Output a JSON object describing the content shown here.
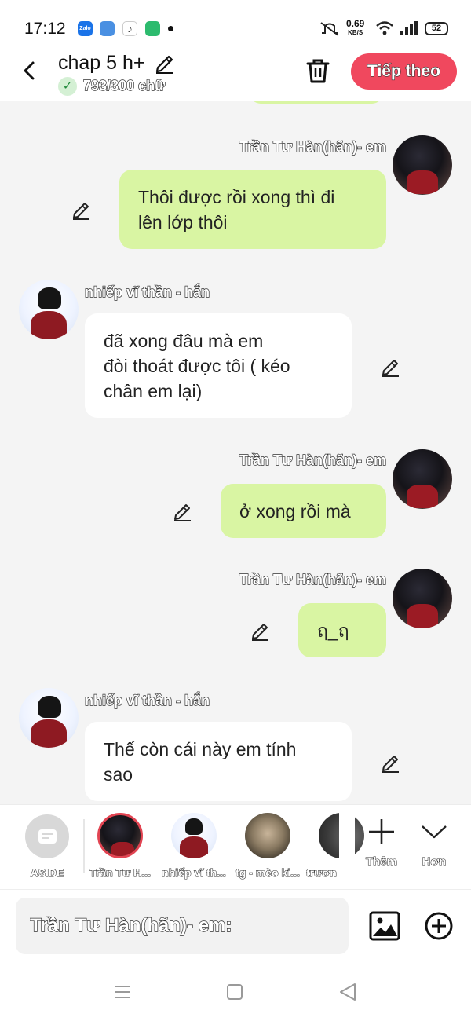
{
  "status_bar": {
    "time": "17:12",
    "apps": [
      "zalo-icon",
      "app-icon",
      "tiktok-icon",
      "battery-saver-icon"
    ],
    "net_speed": "0.69",
    "net_unit": "KB/S",
    "battery": "52",
    "icons": [
      "mute-icon",
      "wifi-icon",
      "signal-icon",
      "battery-icon"
    ]
  },
  "header": {
    "title": "chap 5 h+",
    "word_count": "793/300 chữ",
    "next_label": "Tiếp theo",
    "icons": [
      "back-icon",
      "edit-title-icon",
      "trash-icon"
    ]
  },
  "messages": [
    {
      "side": "right",
      "sender": "Trần Tư Hàn(hãn)- em",
      "avatar": "tran-avatar",
      "text_lines": [
        "Thôi được rồi xong thì đi",
        "lên lớp thôi"
      ]
    },
    {
      "side": "left",
      "sender": "nhiếp vĩ thần - hắn",
      "avatar": "nhiep-avatar",
      "text_lines": [
        "đã xong đâu mà em",
        "đòi thoát được tôi ( kéo",
        "chân em lại)"
      ]
    },
    {
      "side": "right",
      "sender": "Trần Tư Hàn(hãn)- em",
      "avatar": "tran-avatar",
      "text_lines": [
        "ở xong rồi mà"
      ]
    },
    {
      "side": "right",
      "sender": "Trần Tư Hàn(hãn)- em",
      "avatar": "tran-avatar",
      "text_lines": [
        "ฤ_ฤ"
      ]
    },
    {
      "side": "left",
      "sender": "nhiếp vĩ thần - hắn",
      "avatar": "nhiep-avatar",
      "text_lines": [
        "Thế còn cái này em tính",
        "sao"
      ]
    }
  ],
  "character_bar": {
    "items": [
      {
        "label": "ASIDE",
        "selected": false
      },
      {
        "label": "Trần Tư H...",
        "selected": true
      },
      {
        "label": "nhiếp vĩ th...",
        "selected": false
      },
      {
        "label": "tg - mèo ki...",
        "selected": false
      },
      {
        "label": "trươn",
        "selected": false
      }
    ],
    "add_label": "Thêm",
    "more_label": "Hơn"
  },
  "input": {
    "placeholder": "Trần Tư Hàn(hãn)- em:",
    "value": ""
  },
  "colors": {
    "my_bubble": "#d9f5a3",
    "their_bubble": "#ffffff",
    "chat_background": "#f4f4f4",
    "accent": "#f0485e",
    "selected_ring": "#e24452"
  }
}
